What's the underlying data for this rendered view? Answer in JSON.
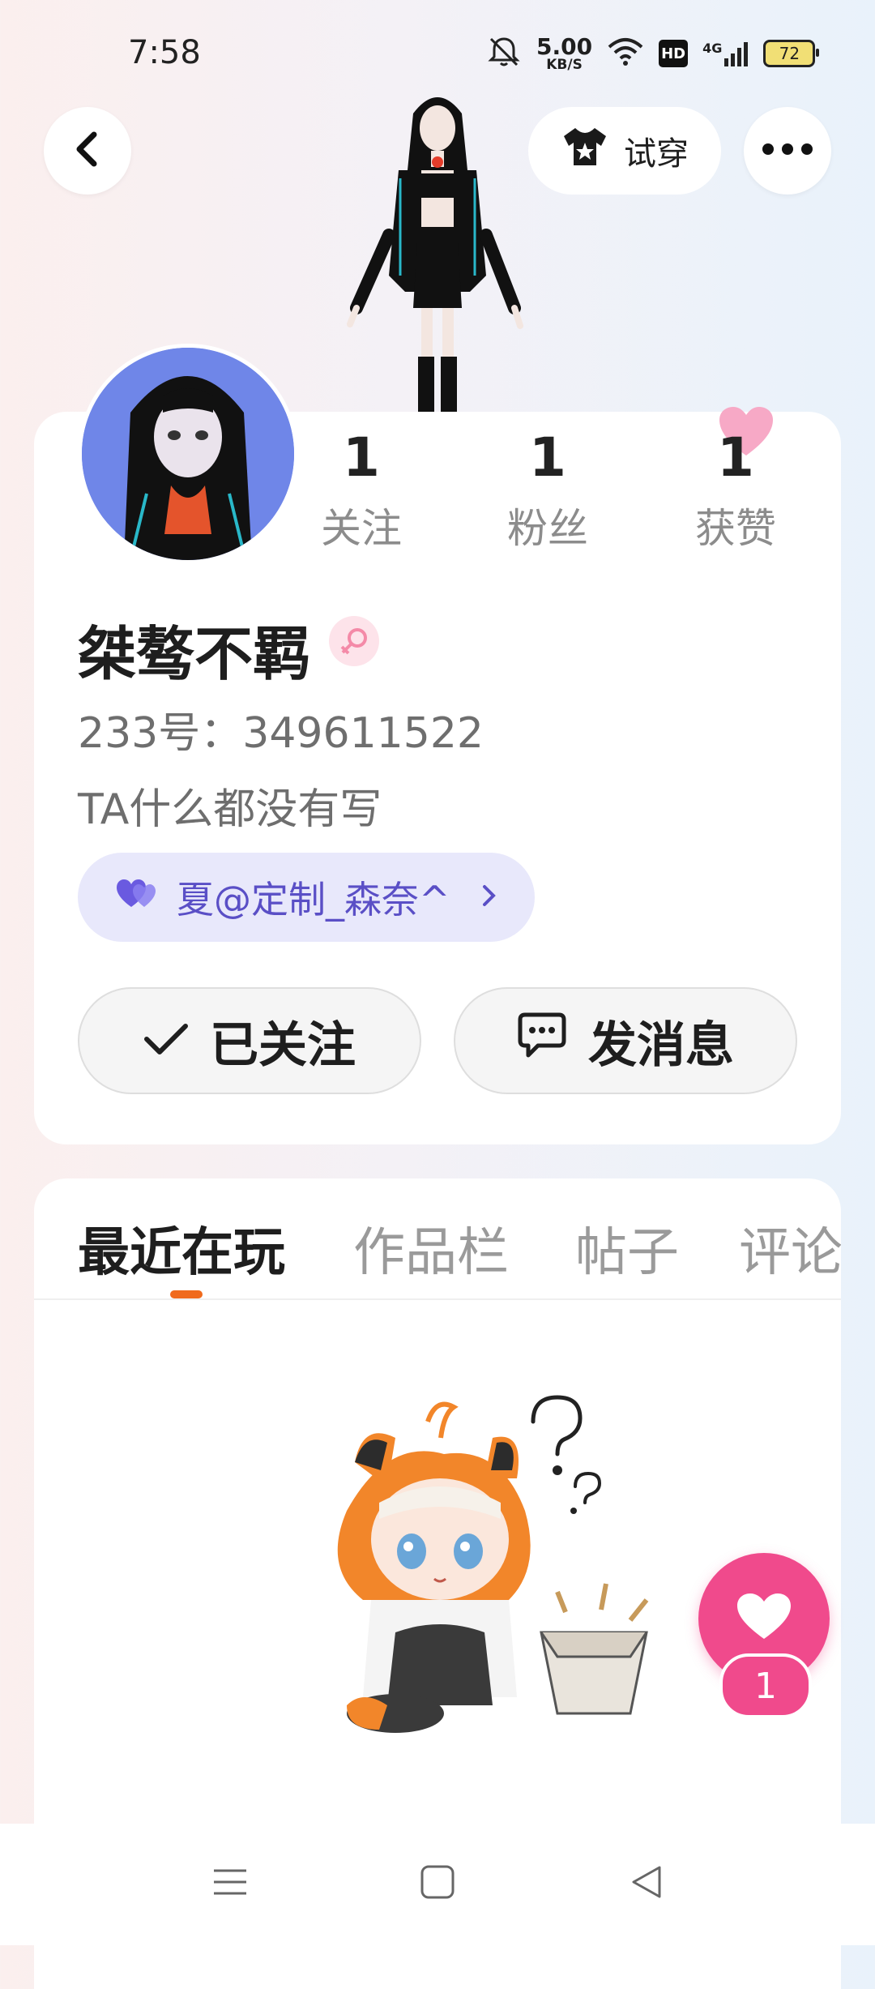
{
  "status_bar": {
    "time": "7:58",
    "net_speed_value": "5.00",
    "net_speed_unit": "KB/S",
    "hd_label": "HD",
    "network": "4G",
    "battery": "72"
  },
  "header": {
    "tryon_label": "试穿",
    "back_icon": "chevron-left-icon",
    "more_icon": "more-dots-icon"
  },
  "profile": {
    "stats": [
      {
        "value": "1",
        "label": "关注"
      },
      {
        "value": "1",
        "label": "粉丝"
      },
      {
        "value": "1",
        "label": "获赞"
      }
    ],
    "username": "桀骜不羁",
    "gender_icon": "female-icon",
    "uid": "233号：349611522",
    "bio": "TA什么都没有写",
    "cp_tag": "夏@定制_森奈^",
    "follow_label": "已关注",
    "message_label": "发消息"
  },
  "tabs": [
    {
      "label": "最近在玩",
      "active": true
    },
    {
      "label": "作品栏",
      "active": false
    },
    {
      "label": "帖子",
      "active": false
    },
    {
      "label": "评论",
      "active": false
    }
  ],
  "floating_like": {
    "count": "1"
  },
  "colors": {
    "accent_orange": "#f06a1d",
    "like_pink": "#f04a8c",
    "tag_purple": "#5a4fc6",
    "tag_bg": "#e8e8fb"
  }
}
